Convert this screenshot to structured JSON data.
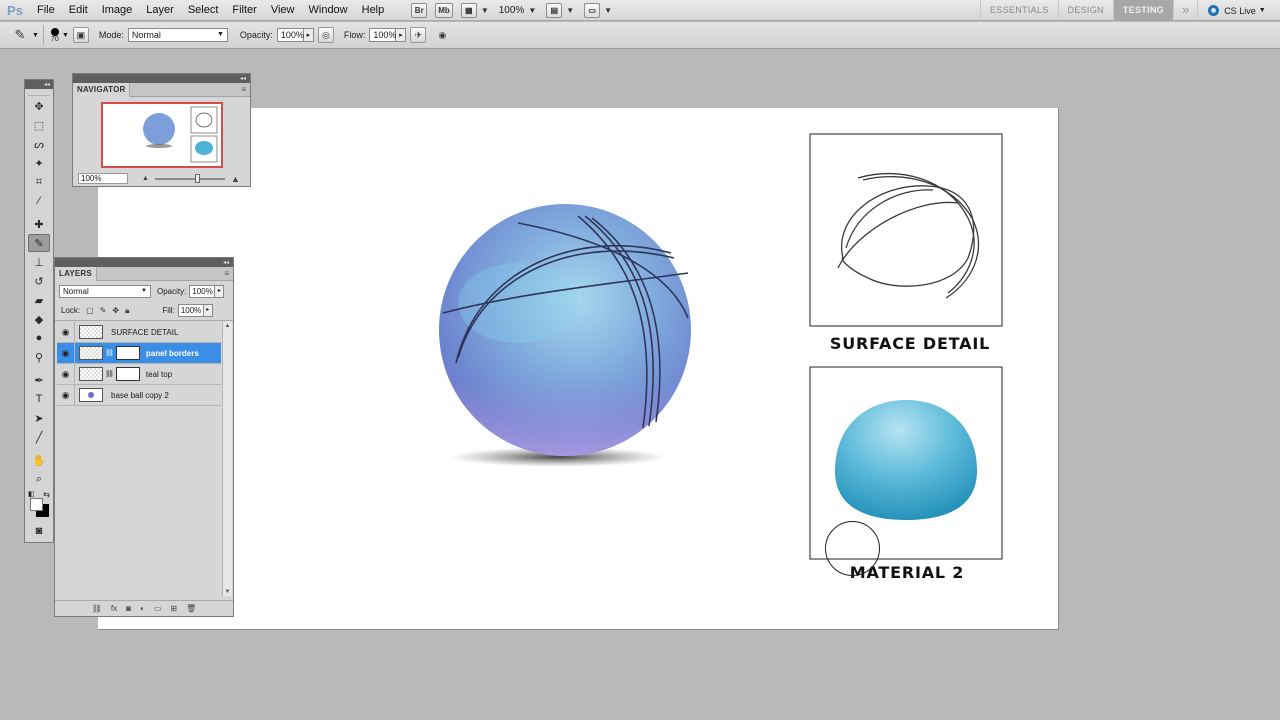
{
  "app": {
    "logo": "Ps",
    "menu": [
      "File",
      "Edit",
      "Image",
      "Layer",
      "Select",
      "Filter",
      "View",
      "Window",
      "Help"
    ],
    "bridge_btn": "Br",
    "minibridge_btn": "Mb",
    "zoom": "100%",
    "workspaces": [
      "ESSENTIALS",
      "DESIGN",
      "TESTING"
    ],
    "active_workspace": "TESTING",
    "cs_live": "CS Live"
  },
  "options": {
    "brush_size": "70",
    "mode_label": "Mode:",
    "mode_value": "Normal",
    "opacity_label": "Opacity:",
    "opacity_value": "100%",
    "flow_label": "Flow:",
    "flow_value": "100%"
  },
  "navigator": {
    "title": "NAVIGATOR",
    "zoom": "100%"
  },
  "layers": {
    "title": "LAYERS",
    "blend_mode": "Normal",
    "opacity_label": "Opacity:",
    "opacity_value": "100%",
    "lock_label": "Lock:",
    "fill_label": "Fill:",
    "fill_value": "100%",
    "items": [
      {
        "name": "SURFACE DETAIL",
        "selected": false,
        "has_mask": false
      },
      {
        "name": "panel borders",
        "selected": true,
        "has_mask": true
      },
      {
        "name": "teal top",
        "selected": false,
        "has_mask": true
      },
      {
        "name": "base ball copy 2",
        "selected": false,
        "has_mask": false
      }
    ]
  },
  "canvas": {
    "label_surface": "SURFACE DETAIL",
    "label_material": "MATERIAL 2"
  },
  "colors": {
    "accent_selection": "#3a8ee6",
    "ball_blue": "#6f9bd6",
    "ball_purple": "#8f86cf",
    "teal": "#36a3c9"
  }
}
